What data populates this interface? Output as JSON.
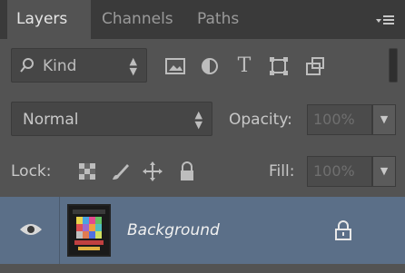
{
  "tabs": [
    {
      "label": "Layers",
      "active": true
    },
    {
      "label": "Channels",
      "active": false
    },
    {
      "label": "Paths",
      "active": false
    }
  ],
  "menu_icon": "panel-menu-icon",
  "filter": {
    "kind_label": "Kind",
    "icons": [
      "pixel-layer-filter-icon",
      "adjustment-layer-filter-icon",
      "type-layer-filter-icon",
      "shape-layer-filter-icon",
      "smart-object-filter-icon"
    ],
    "type_glyph": "T"
  },
  "blend": {
    "mode": "Normal",
    "opacity_label": "Opacity:",
    "opacity_value": "100%"
  },
  "lock": {
    "label": "Lock:",
    "icons": [
      "lock-transparent-pixels-icon",
      "lock-image-pixels-icon",
      "lock-position-icon",
      "lock-all-icon"
    ],
    "fill_label": "Fill:",
    "fill_value": "100%"
  },
  "layers": [
    {
      "name": "Background",
      "visible": true,
      "locked": true,
      "selected": true
    }
  ],
  "colors": {
    "panel_bg": "#535353",
    "tab_bar_bg": "#3a3a3a",
    "selected_layer_bg": "#5b6f88"
  }
}
